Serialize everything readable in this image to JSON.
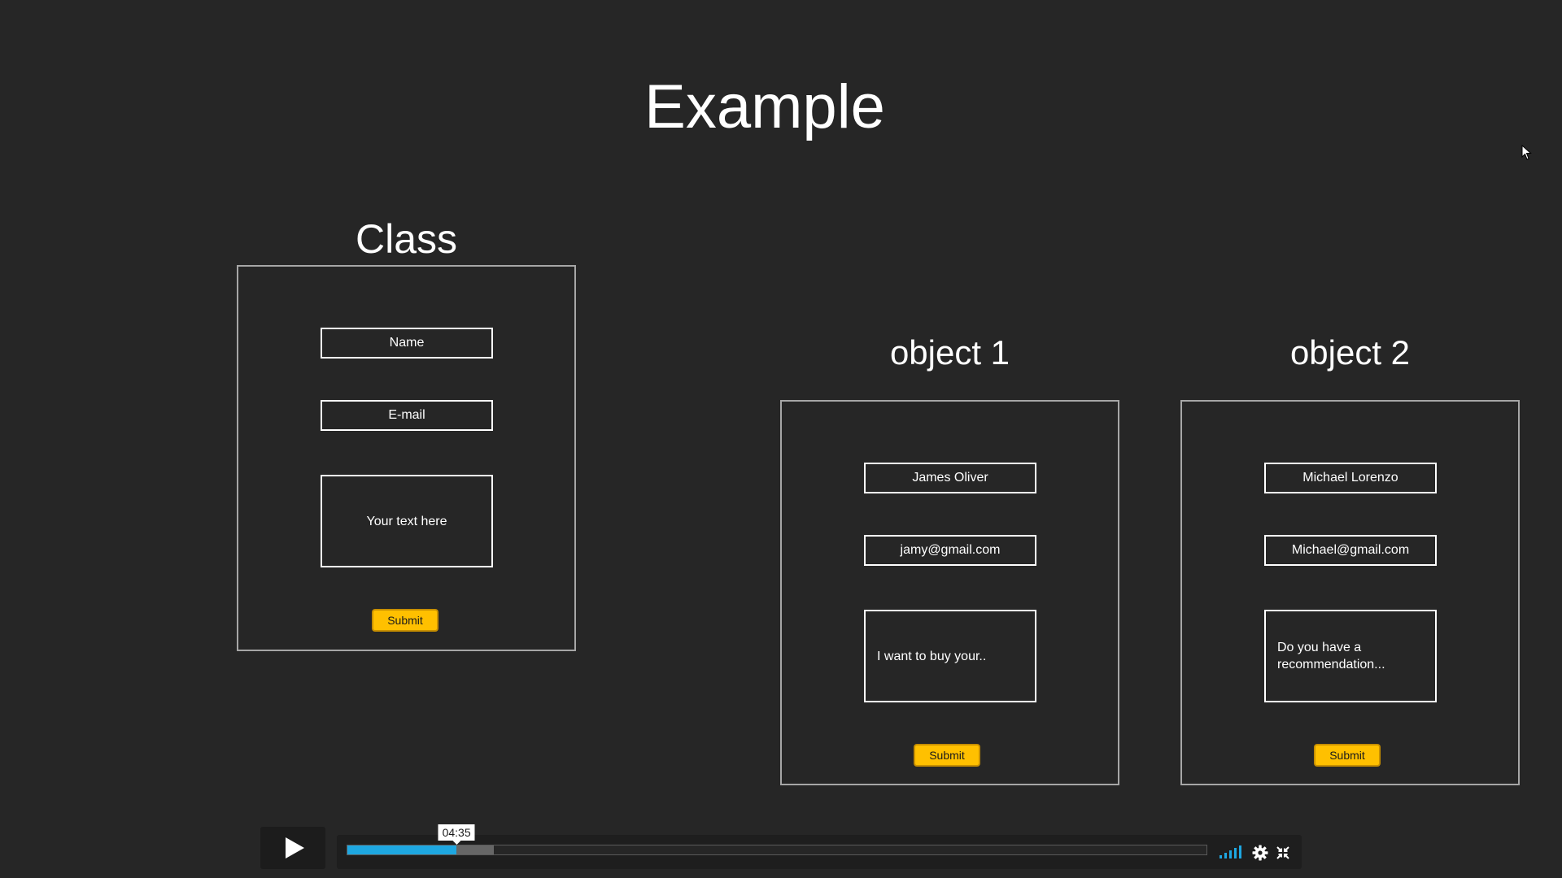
{
  "slide": {
    "title": "Example",
    "class_panel": {
      "heading": "Class",
      "name_field": "Name",
      "email_field": "E-mail",
      "message_field": "Your text here",
      "submit_label": "Submit"
    },
    "object1_panel": {
      "heading": "object 1",
      "name_field": "James Oliver",
      "email_field": "jamy@gmail.com",
      "message_field": "I want to buy your..",
      "submit_label": "Submit"
    },
    "object2_panel": {
      "heading": "object 2",
      "name_field": "Michael Lorenzo",
      "email_field": "Michael@gmail.com",
      "message_field": "Do you have a recommendation...",
      "submit_label": "Submit"
    }
  },
  "player": {
    "hover_time": "04:35",
    "played_fraction": 0.127,
    "buffered_fraction": 0.17,
    "volume_level_bars": 5,
    "volume_bars_total": 5,
    "icons": {
      "play": "play-icon",
      "volume": "volume-bars-icon",
      "settings": "gear-icon",
      "fullscreen": "fullscreen-icon"
    },
    "accent_color": "#1ea7e1"
  },
  "colors": {
    "background": "#262626",
    "submit_button": "#ffc000",
    "panel_border": "#a6a6a6"
  }
}
